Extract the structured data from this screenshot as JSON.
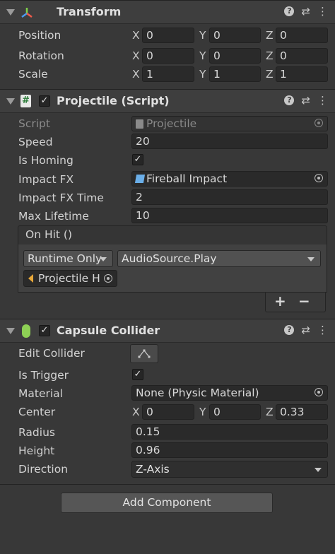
{
  "transform": {
    "title": "Transform",
    "rows": [
      {
        "label": "Position",
        "x": "0",
        "y": "0",
        "z": "0"
      },
      {
        "label": "Rotation",
        "x": "0",
        "y": "0",
        "z": "0"
      },
      {
        "label": "Scale",
        "x": "1",
        "y": "1",
        "z": "1"
      }
    ]
  },
  "axes": {
    "x": "X",
    "y": "Y",
    "z": "Z"
  },
  "projectile": {
    "title": "Projectile (Script)",
    "script_label": "Script",
    "script_value": "Projectile",
    "speed_label": "Speed",
    "speed_value": "20",
    "is_homing_label": "Is Homing",
    "is_homing_checked": true,
    "impact_fx_label": "Impact FX",
    "impact_fx_value": "Fireball Impact",
    "impact_fx_time_label": "Impact FX Time",
    "impact_fx_time_value": "2",
    "max_lifetime_label": "Max Lifetime",
    "max_lifetime_value": "10",
    "on_hit": {
      "title": "On Hit ()",
      "runtime_option": "Runtime Only",
      "function": "AudioSource.Play",
      "target": "Projectile H",
      "add_label": "+",
      "remove_label": "−"
    }
  },
  "capsule": {
    "title": "Capsule Collider",
    "edit_collider_label": "Edit Collider",
    "is_trigger_label": "Is Trigger",
    "is_trigger_checked": true,
    "material_label": "Material",
    "material_value": "None (Physic Material)",
    "center_label": "Center",
    "center": {
      "x": "0",
      "y": "0",
      "z": "0.33"
    },
    "radius_label": "Radius",
    "radius_value": "0.15",
    "height_label": "Height",
    "height_value": "0.96",
    "direction_label": "Direction",
    "direction_value": "Z-Axis"
  },
  "add_component_label": "Add Component",
  "icons": {
    "help": "?",
    "settings": "⇄",
    "more": "⋮",
    "check": "✓",
    "script_hash": "#"
  }
}
